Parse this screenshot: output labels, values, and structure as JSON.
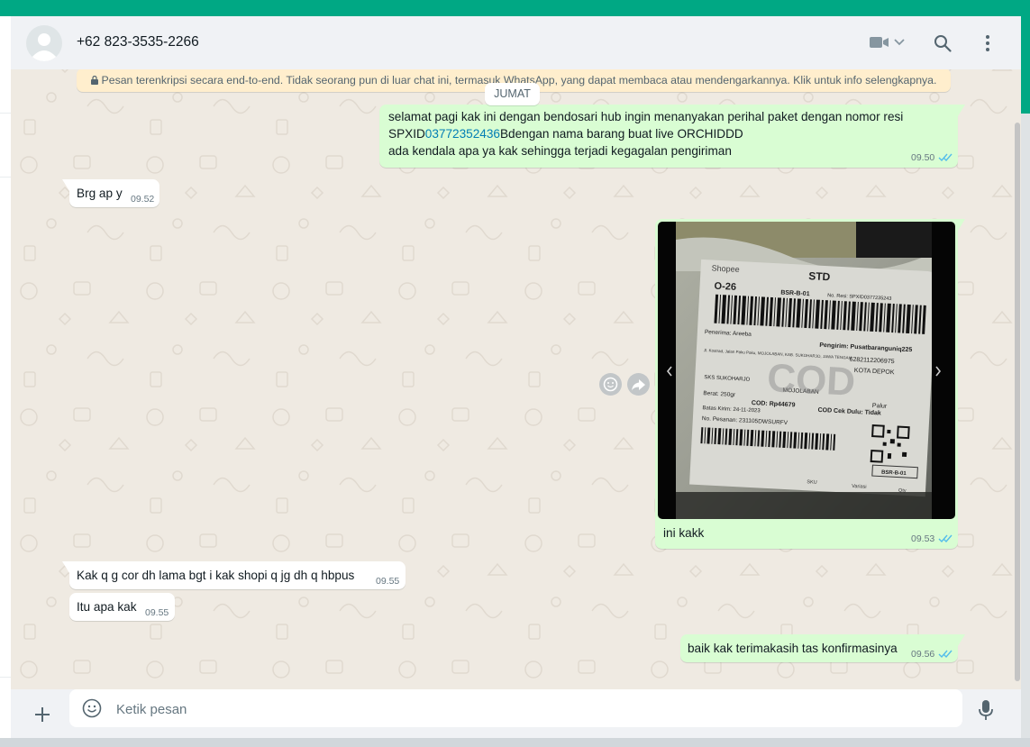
{
  "colors": {
    "brand": "#00a884",
    "outgoing_bubble": "#d9fdd3",
    "incoming_bubble": "#ffffff",
    "chat_background": "#efeae2",
    "read_ticks": "#53bdeb",
    "link": "#027eb5"
  },
  "header": {
    "contact_name": "+62 823-3535-2266",
    "icons": [
      "avatar",
      "video-call-icon",
      "chevron-down-icon",
      "search-icon",
      "menu-icon"
    ]
  },
  "encryption_notice": "Pesan terenkripsi secara end-to-end. Tidak seorang pun di luar chat ini, termasuk WhatsApp, yang dapat membaca atau mendengarkannya. Klik untuk info selengkapnya.",
  "date_divider": "JUMAT",
  "messages": [
    {
      "direction": "out",
      "line1": "selamat pagi kak ini dengan bendosari hub ingin menanyakan perihal paket dengan nomor resi",
      "line2_before": "SPXID",
      "line2_link": "03772352436",
      "line2_after": "Bdengan nama barang  buat live ORCHIDDD",
      "line3": "ada kendala apa ya kak sehingga terjadi kegagalan pengiriman",
      "time": "09.50",
      "status": "read"
    },
    {
      "direction": "in",
      "text": "Brg ap y",
      "time": "09.52"
    },
    {
      "direction": "out",
      "type": "image",
      "caption": "ini kakk",
      "time": "09.53",
      "status": "read",
      "label": {
        "brand": "Shopee",
        "service": "STD",
        "sort_code": "O-26",
        "hub_code": "BSR-B-01",
        "resi_label": "No. Resi: SPXID0377235243",
        "recipient": "Penerima: Areeba",
        "sender": "Pengirim: Pusatbaranguniq225",
        "address": "Jl. Kostrad, Jalan Paku Paku, MOJOLABAN, KAB. SUKOHARJO, JAWA TENGAH",
        "phone": "6282112206975",
        "city": "KOTA DEPOK",
        "origin": "SKS SUKOHARJO",
        "district": "MOJOLABAN",
        "destination": "Palur",
        "weight": "Berat: 250gr",
        "cod": "COD: Rp44679",
        "cod_check": "COD Cek Dulu: Tidak",
        "ship_date": "Batas Kirim: 24-11-2023",
        "order_no": "No. Pesanan: 231105DWSURFV",
        "stamp": "COD",
        "sku": "SKU",
        "variant": "Variasi",
        "qty": "Qty"
      }
    },
    {
      "direction": "in",
      "text": "Kak q g cor dh lama bgt i kak shopi q jg dh q hbpus",
      "time": "09.55"
    },
    {
      "direction": "in",
      "text": "Itu apa kak",
      "time": "09.55"
    },
    {
      "direction": "out",
      "text": "baik kak terimakasih tas konfirmasinya",
      "time": "09.56",
      "status": "read"
    }
  ],
  "composer": {
    "placeholder": "Ketik pesan",
    "icons": [
      "plus-icon",
      "emoji-icon",
      "microphone-icon"
    ]
  }
}
